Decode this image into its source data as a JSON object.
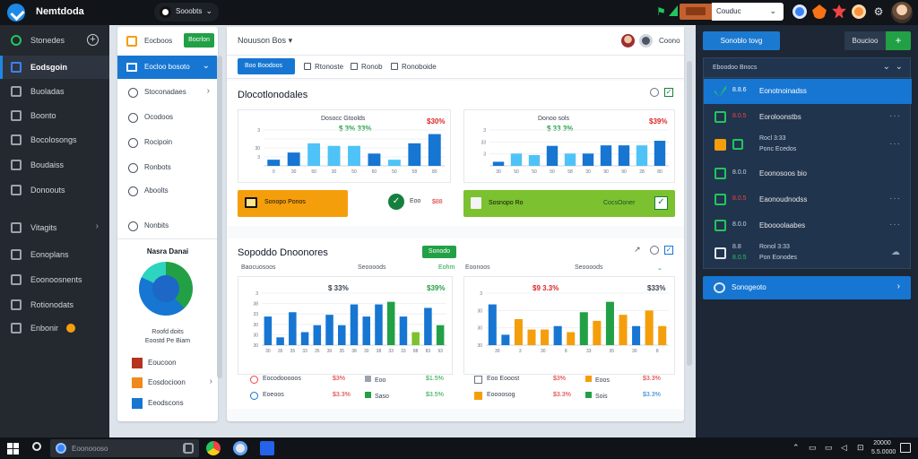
{
  "topbar": {
    "title": "Nemtdoda",
    "workspace": "Sooobts",
    "account": "Couduc"
  },
  "sidebar": {
    "items": [
      {
        "label": "Stonedes",
        "icon": "home-icon"
      },
      {
        "label": "Eodsgoin",
        "icon": "dashboard-icon"
      },
      {
        "label": "Buoladas",
        "icon": "layers-icon"
      },
      {
        "label": "Boonto",
        "icon": "briefcase-icon"
      },
      {
        "label": "Bocolosongs",
        "icon": "document-icon"
      },
      {
        "label": "Boudaiss",
        "icon": "tag-icon"
      },
      {
        "label": "Donoouts",
        "icon": "chart-icon"
      },
      {
        "label": "Vitagits",
        "icon": "gear-icon"
      },
      {
        "label": "Eonoplans",
        "icon": "calendar-icon"
      },
      {
        "label": "Eoonoosnents",
        "icon": "folder-icon"
      },
      {
        "label": "Rotionodats",
        "icon": "list-icon"
      },
      {
        "label": "Enbonir",
        "icon": "user-icon"
      }
    ]
  },
  "nav_panel": {
    "header_label": "Eocboos",
    "header_button": "Bocrlon",
    "active_item": "Eocloo bosoto",
    "items": [
      "Stoconadaes",
      "Ocodoos",
      "Rocipoin",
      "Ronbots",
      "Aboolts",
      "Nonbits"
    ],
    "donut_title": "Nasra Danai",
    "donut_caption_1": "Roofd doits",
    "donut_caption_2": "Eoostd Pe Biam",
    "legend": [
      {
        "label": "Eoucoon",
        "color": "#b5331f"
      },
      {
        "label": "Eosdocioon",
        "color": "#f08a1c"
      },
      {
        "label": "Eeodscons",
        "color": "#1676d2"
      }
    ]
  },
  "main": {
    "header_title": "Nouuson Bos",
    "user_name": "Coono",
    "tabs": [
      {
        "label": "Boo Boodoos"
      },
      {
        "label": "Rtonoste"
      },
      {
        "label": "Ronob"
      },
      {
        "label": "Ronoboide"
      }
    ],
    "top_panel_title": "Dlocotlonodales",
    "chart_left": {
      "title": "Dosocc Gtoolds",
      "kpi_value": "$ 3% 33%",
      "kpi_pct": "$30%"
    },
    "chart_right": {
      "title": "Donoo sols",
      "kpi_value": "$ 33 3%",
      "kpi_pct": "$39%"
    },
    "kpi_orange_label": "Sonopo Ponos",
    "kpi_mid_label": "Eoo",
    "kpi_mid_value": "$88",
    "kpi_green_label": "Sosnopo Ro",
    "kpi_green_label2": "CocsOoner",
    "bottom_panel_title": "Sopoddo Dnoonores",
    "bottom_tag": "Sonodo",
    "col_heads": [
      "Baocuosoos",
      "Seoooods",
      "Eohm",
      "Eoonoos"
    ],
    "chart_bl": {
      "kpi_value": "$ 33%",
      "kpi_pct": "$39%"
    },
    "chart_br": {
      "kpi_value": "$9 3.3%",
      "kpi_pct": "$33%"
    },
    "legend_bl": [
      {
        "label": "Eocodooooos",
        "value": "$3%",
        "v2lbl": "Eoo",
        "v2": "$1.5%",
        "color": "#ef4444"
      },
      {
        "label": "Eoeoos",
        "value": "$3.3%",
        "v2lbl": "Saso",
        "v2": "$3.5%",
        "color": "#1676d2"
      }
    ],
    "legend_br": [
      {
        "label": "Eoo Eooost",
        "value": "$3%",
        "v2lbl": "Eoos",
        "v2": "$3.3%",
        "color": "#6b7280"
      },
      {
        "label": "Eoooosog",
        "value": "$3.3%",
        "v2lbl": "Sois",
        "v2": "$3.3%",
        "color": "#f59e0b"
      }
    ]
  },
  "chart_data": [
    {
      "type": "bar",
      "series": [
        {
          "values": [
            1.2,
            2.6,
            4.4,
            3.9,
            3.9,
            2.4,
            1.2,
            4.4,
            6.2
          ]
        }
      ],
      "ylim": [
        0,
        7
      ],
      "ytick_labels": [
        "",
        "3",
        "30",
        "",
        "3"
      ],
      "xtick_labels": [
        "0",
        "30",
        "50",
        "30",
        "50",
        "60",
        "50",
        "58",
        "80"
      ],
      "colors": [
        "#1676d2",
        "#1676d2",
        "#4fc3f7",
        "#4fc3f7",
        "#4fc3f7",
        "#1676d2",
        "#4fc3f7",
        "#1676d2",
        "#1676d2"
      ]
    },
    {
      "type": "bar",
      "series": [
        {
          "values": [
            0.8,
            2.4,
            2.1,
            3.9,
            2.4,
            2.4,
            4.0,
            4.0,
            4.0,
            4.9
          ]
        }
      ],
      "ylim": [
        0,
        7
      ],
      "ytick_labels": [
        "",
        "3",
        "33",
        "3"
      ],
      "xtick_labels": [
        "30",
        "50",
        "50",
        "50",
        "58",
        "30",
        "90",
        "90",
        "28",
        "80"
      ],
      "colors": [
        "#1676d2",
        "#4fc3f7",
        "#4fc3f7",
        "#1676d2",
        "#4fc3f7",
        "#1676d2",
        "#1676d2",
        "#1676d2",
        "#4fc3f7",
        "#1676d2"
      ]
    },
    {
      "type": "bar",
      "series": [
        {
          "values": [
            3.3,
            0.9,
            3.8,
            1.5,
            2.3,
            3.5,
            2.3,
            4.7,
            3.3,
            4.7,
            5.0,
            3.3,
            1.5,
            4.3,
            2.3
          ]
        }
      ],
      "ylim": [
        0,
        6
      ],
      "ytick_labels": [
        "30",
        "30",
        "30",
        "33",
        "38",
        "3"
      ],
      "xtick_labels": [
        "30",
        "35",
        "35",
        "33",
        "35",
        "30",
        "35",
        "38",
        "30",
        "38",
        "33",
        "33",
        "88",
        "83",
        "93"
      ],
      "colors": [
        "#1676d2",
        "#1676d2",
        "#1676d2",
        "#1676d2",
        "#1676d2",
        "#1676d2",
        "#1676d2",
        "#1676d2",
        "#1676d2",
        "#1676d2",
        "#22a046",
        "#1676d2",
        "#7cc12f",
        "#1676d2",
        "#22a046"
      ]
    },
    {
      "type": "bar",
      "series": [
        {
          "values": [
            4.7,
            1.2,
            3.0,
            1.8,
            1.8,
            2.2,
            1.5,
            3.8,
            2.8,
            5.0,
            3.5,
            2.2,
            4.0,
            2.2
          ]
        }
      ],
      "ylim": [
        0,
        6
      ],
      "ytick_labels": [
        "30",
        "30",
        "30",
        "3"
      ],
      "xtick_labels": [
        "30",
        "3",
        "30",
        "8",
        "33",
        "35",
        "30",
        "8"
      ],
      "colors": [
        "#1676d2",
        "#1676d2",
        "#f59e0b",
        "#f59e0b",
        "#f59e0b",
        "#1676d2",
        "#f59e0b",
        "#22a046",
        "#f59e0b",
        "#22a046",
        "#f59e0b",
        "#1676d2",
        "#f59e0b",
        "#f59e0b"
      ]
    }
  ],
  "right_panel": {
    "top_button": "Sonoblo tovg",
    "dark_button": "Boucioo",
    "green_button": "+",
    "list_header": "Eboodoo Bnocs",
    "rows": [
      {
        "code": "8.8.6",
        "name": "Eonotnoinadss",
        "icon_color": "#22c55e"
      },
      {
        "code": "8.0.5",
        "name": "Eoroloonstbs",
        "icon_color": "#22c55e"
      },
      {
        "code": "",
        "name": "Rocl 3:33",
        "name2": "Ponc Ecedos",
        "icon_color": "#f59e0b"
      },
      {
        "code": "8.0.0",
        "name": "Eoonosoos bio",
        "icon_color": "#22c55e"
      },
      {
        "code": "8.0.5",
        "name": "Eaonoudnodss",
        "icon_color": "#22c55e"
      },
      {
        "code": "8.0.0",
        "name": "Eboooolaabes",
        "icon_color": "#22c55e"
      },
      {
        "code": "8.0.5",
        "name": "Ronol 3:33",
        "name2": "Pon Eonodes",
        "icon_color": "#22c55e"
      }
    ],
    "footer_label": "Sonogeoto"
  },
  "taskbar": {
    "search_placeholder": "Eoonoooso",
    "clock_time": "20000",
    "clock_date": "5.5.0000"
  }
}
